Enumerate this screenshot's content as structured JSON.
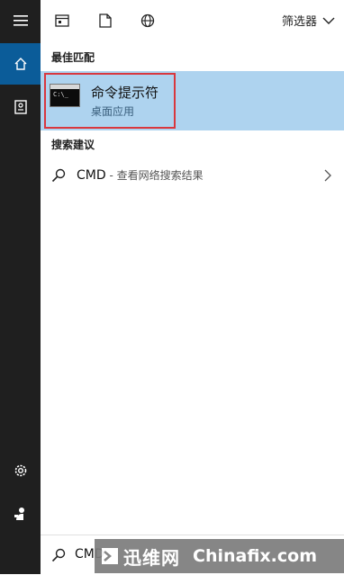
{
  "rail": {
    "icons": [
      "hamburger-icon",
      "home-icon",
      "notebook-icon",
      "gear-icon",
      "user-icon"
    ]
  },
  "toolbar": {
    "icons": [
      "calendar-icon",
      "document-icon",
      "globe-icon"
    ],
    "filter_label": "筛选器"
  },
  "best_match": {
    "heading": "最佳匹配",
    "title": "命令提示符",
    "subtitle": "桌面应用",
    "icon_text": "C:\\_"
  },
  "suggestions": {
    "heading": "搜索建议",
    "items": [
      {
        "query": "CMD",
        "detail": " - 查看网络搜索结果"
      }
    ]
  },
  "search": {
    "value": "CMD"
  },
  "watermark": {
    "cn": "迅维网",
    "en": "Chinafix.com"
  },
  "colors": {
    "rail": "#1f1f1f",
    "rail_active": "#0b5c99",
    "highlight": "#aed3ef",
    "frame": "#d9373e"
  }
}
